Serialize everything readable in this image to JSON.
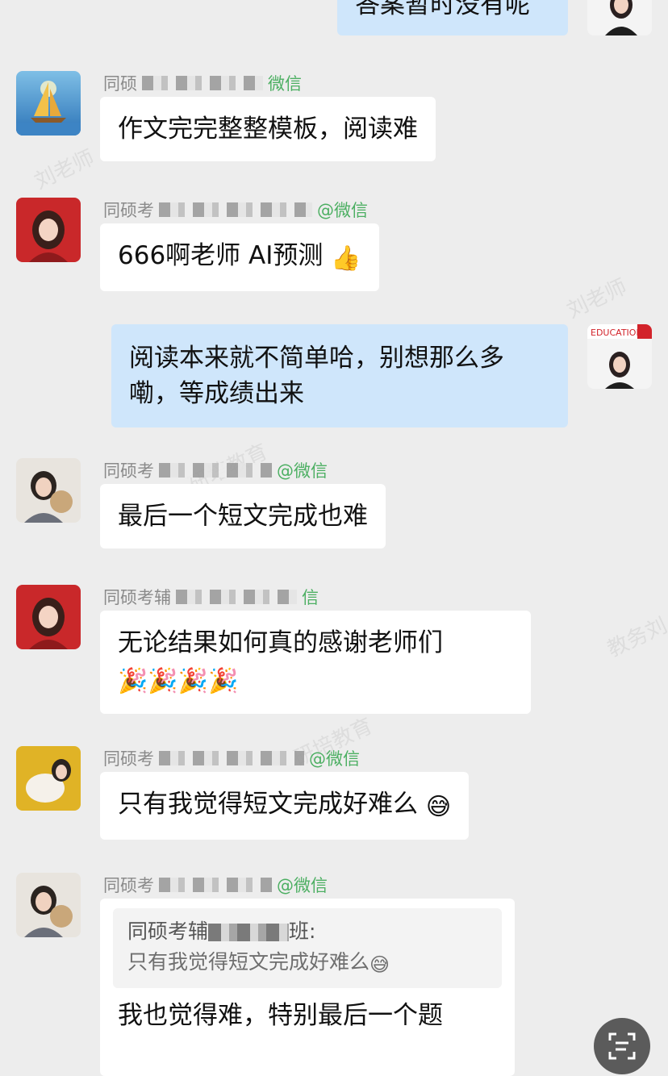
{
  "colors": {
    "background": "#ededed",
    "my_bubble": "#cfe6fb",
    "their_bubble": "#ffffff",
    "wechat_green": "#4caf62"
  },
  "messages": [
    {
      "text": "答案暂时没有呢"
    },
    {
      "sender_prefix": "同硕",
      "sender_suffix": "微信",
      "text": "作文完完整整模板，阅读难"
    },
    {
      "sender_prefix": "同硕考",
      "sender_suffix": "@微信",
      "text": "666啊老师 AI预测",
      "emoji": "👍"
    },
    {
      "text": "阅读本来就不简单哈，别想那么多嘞，等成绩出来",
      "avatar_banner": "EDUCATION"
    },
    {
      "sender_prefix": "同硕考",
      "sender_suffix": "@微信",
      "text": "最后一个短文完成也难"
    },
    {
      "sender_prefix": "同硕考辅",
      "sender_suffix": "信",
      "text": "无论结果如何真的感谢老师们",
      "emoji": "🎉🎉🎉🎉"
    },
    {
      "sender_prefix": "同硕考",
      "sender_suffix": "@微信",
      "text": "只有我觉得短文完成好难么",
      "emoji": "😅"
    },
    {
      "sender_prefix": "同硕考",
      "sender_suffix": "@微信",
      "quote_name_prefix": "同硕考辅",
      "quote_name_suffix": "班:",
      "quote_text": "只有我觉得短文完成好难么",
      "quote_emoji": "😅",
      "text": "我也觉得难，特别最后一个题"
    }
  ],
  "watermarks": [
    "刘老师",
    "研培教育",
    "教务刘"
  ],
  "icons": {
    "scan": "scan-icon"
  }
}
